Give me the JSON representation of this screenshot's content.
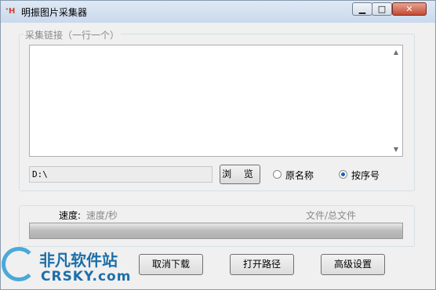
{
  "window": {
    "title": "明振图片采集器"
  },
  "url_group": {
    "label": "采集链接（一行一个）"
  },
  "path": {
    "value": "D:\\"
  },
  "browse_button": "浏 览",
  "naming": {
    "options": [
      {
        "label": "原名称",
        "checked": false
      },
      {
        "label": "按序号",
        "checked": true
      }
    ]
  },
  "progress": {
    "speed_label": "速度:",
    "speed_value": "速度/秒",
    "file_count": "文件/总文件",
    "percent": 0
  },
  "actions": {
    "cancel": "取消下载",
    "open_path": "打开路径",
    "advanced": "高级设置"
  },
  "watermark": {
    "text": "非凡软件站",
    "sub": "CRSKY.com"
  },
  "colors": {
    "accent": "#1a5fb4",
    "watermark": "#1d6fa8"
  }
}
